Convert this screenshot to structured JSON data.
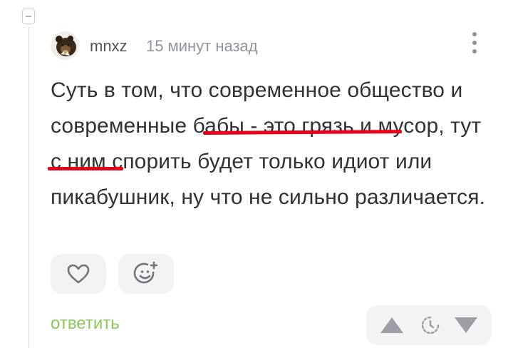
{
  "comment": {
    "username": "mnxz",
    "timestamp": "15 минут назад",
    "text_part1": "Суть в том, что современное общество и современные ",
    "text_highlight1": "бабы - это грязь и",
    "text_part2": " ",
    "text_highlight2": "мусор,",
    "text_part3": " тут с ним спорить будет только идиот или пикабушник, ну что не сильно различается."
  },
  "actions": {
    "reply_label": "ответить"
  },
  "icons": {
    "collapse": "collapse-thread-icon",
    "more": "more-vertical-icon",
    "like": "heart-icon",
    "emoji": "add-emoji-icon",
    "upvote": "upvote-arrow-icon",
    "timer": "rating-timer-icon",
    "downvote": "downvote-arrow-icon"
  },
  "colors": {
    "reply": "#8ac858",
    "underline": "#e8001c",
    "icon_gray": "#9b9fa5"
  }
}
